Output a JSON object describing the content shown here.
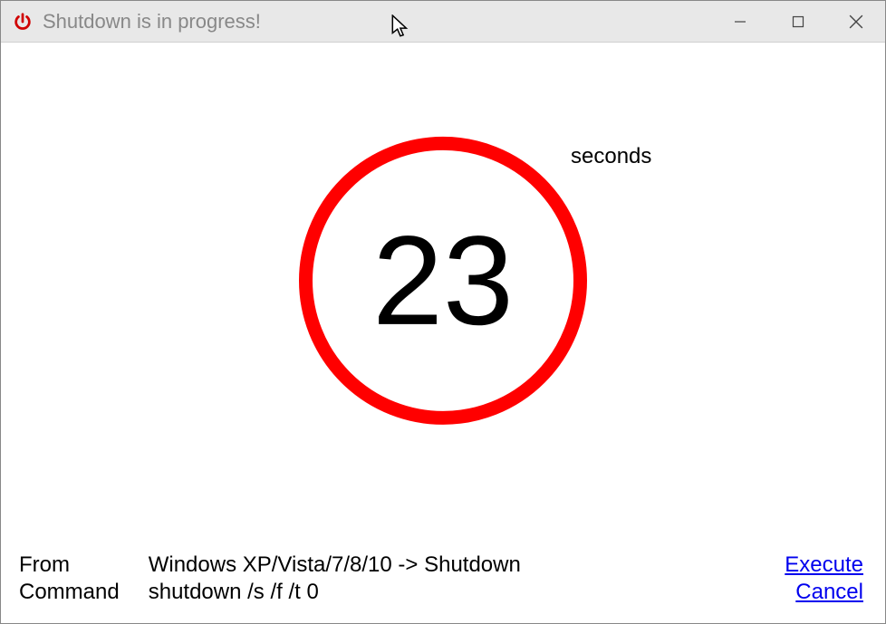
{
  "window": {
    "title": "Shutdown is in progress!"
  },
  "countdown": {
    "value": "23",
    "unit_label": "seconds"
  },
  "info": {
    "from_label": "From",
    "from_value": "Windows XP/Vista/7/8/10 -> Shutdown",
    "command_label": "Command",
    "command_value": "shutdown /s /f /t 0"
  },
  "actions": {
    "execute": "Execute",
    "cancel": "Cancel"
  }
}
